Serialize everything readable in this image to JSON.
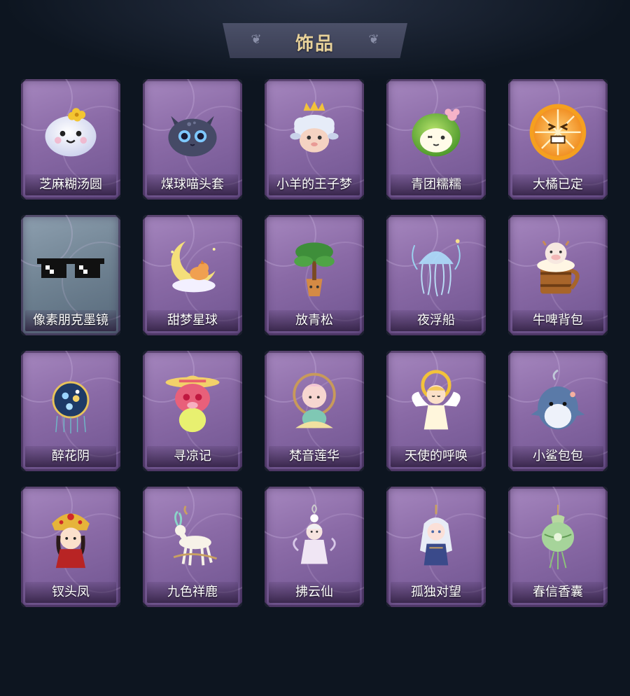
{
  "header": {
    "title": "饰品"
  },
  "items": [
    {
      "name": "芝麻糊汤圆",
      "icon": "tangyuan-icon",
      "frame": "purple"
    },
    {
      "name": "煤球喵头套",
      "icon": "cat-head-icon",
      "frame": "purple"
    },
    {
      "name": "小羊的王子梦",
      "icon": "sheep-crown-icon",
      "frame": "purple"
    },
    {
      "name": "青团糯糯",
      "icon": "green-rice-ball-icon",
      "frame": "purple"
    },
    {
      "name": "大橘已定",
      "icon": "orange-slice-icon",
      "frame": "purple"
    },
    {
      "name": "像素朋克墨镜",
      "icon": "pixel-sunglasses-icon",
      "frame": "gray"
    },
    {
      "name": "甜梦星球",
      "icon": "moon-fox-icon",
      "frame": "purple"
    },
    {
      "name": "放青松",
      "icon": "pine-tree-pot-icon",
      "frame": "purple"
    },
    {
      "name": "夜浮船",
      "icon": "jellyfish-icon",
      "frame": "purple"
    },
    {
      "name": "牛啤背包",
      "icon": "cow-beer-mug-icon",
      "frame": "purple"
    },
    {
      "name": "醉花阴",
      "icon": "flower-lantern-icon",
      "frame": "purple"
    },
    {
      "name": "寻凉记",
      "icon": "pink-bear-hat-icon",
      "frame": "purple"
    },
    {
      "name": "梵音莲华",
      "icon": "lotus-child-icon",
      "frame": "purple"
    },
    {
      "name": "天使的呼唤",
      "icon": "angel-icon",
      "frame": "purple"
    },
    {
      "name": "小鲨包包",
      "icon": "shark-bag-icon",
      "frame": "purple"
    },
    {
      "name": "钗头凤",
      "icon": "phoenix-crown-doll-icon",
      "frame": "purple"
    },
    {
      "name": "九色祥鹿",
      "icon": "deer-icon",
      "frame": "purple"
    },
    {
      "name": "拂云仙",
      "icon": "cloud-fairy-charm-icon",
      "frame": "purple"
    },
    {
      "name": "孤独对望",
      "icon": "silver-hair-charm-icon",
      "frame": "purple"
    },
    {
      "name": "春信香囊",
      "icon": "sachet-icon",
      "frame": "purple"
    }
  ],
  "colors": {
    "background": "#0d1520",
    "card_purple": "#8a6aa6",
    "card_gray": "#6f8292",
    "title_gold": "#e8d29a"
  }
}
